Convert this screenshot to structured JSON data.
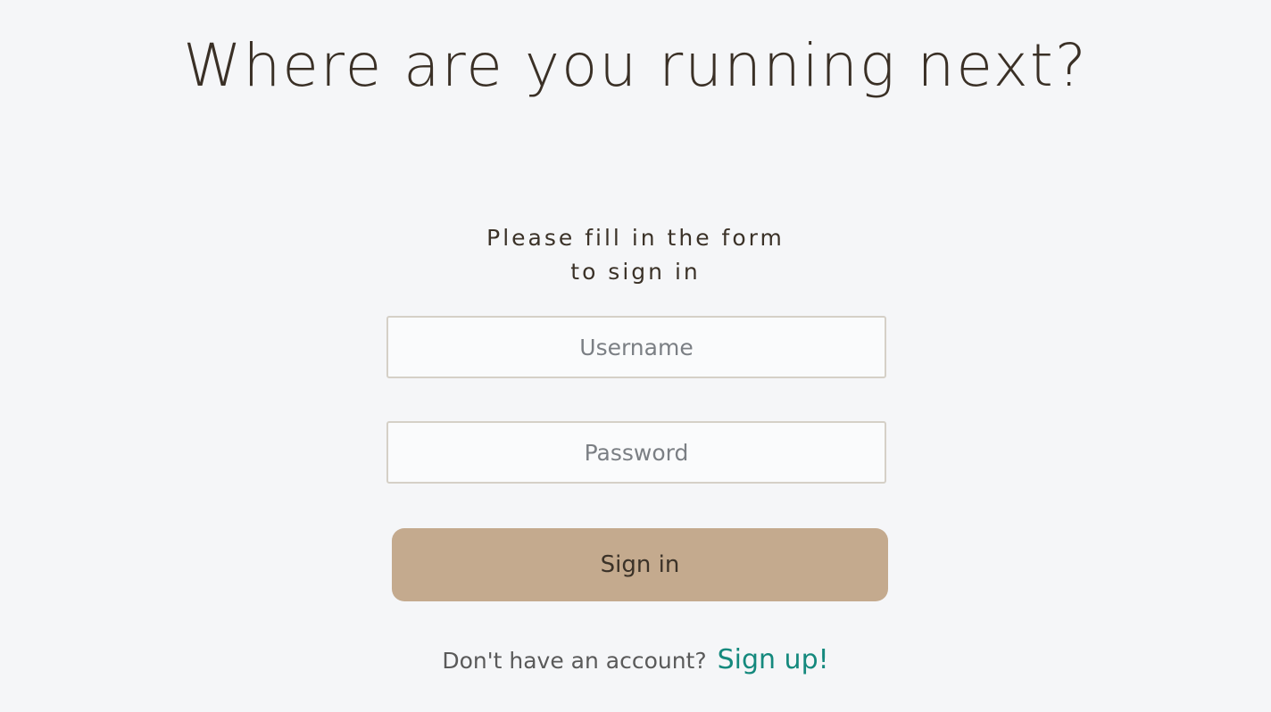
{
  "header": {
    "title": "Where are you running next?"
  },
  "form": {
    "intro_line1": "Please fill in the form",
    "intro_line2": "to sign in",
    "username": {
      "value": "",
      "placeholder": "Username"
    },
    "password": {
      "value": "",
      "placeholder": "Password"
    },
    "submit_label": "Sign in"
  },
  "footer": {
    "prompt": "Don't have an account?",
    "signup_label": "Sign up!"
  },
  "colors": {
    "background": "#f5f6f8",
    "text": "#3b3228",
    "button": "#c4aa8e",
    "link": "#14897d",
    "field_border": "#d5d0c7"
  }
}
